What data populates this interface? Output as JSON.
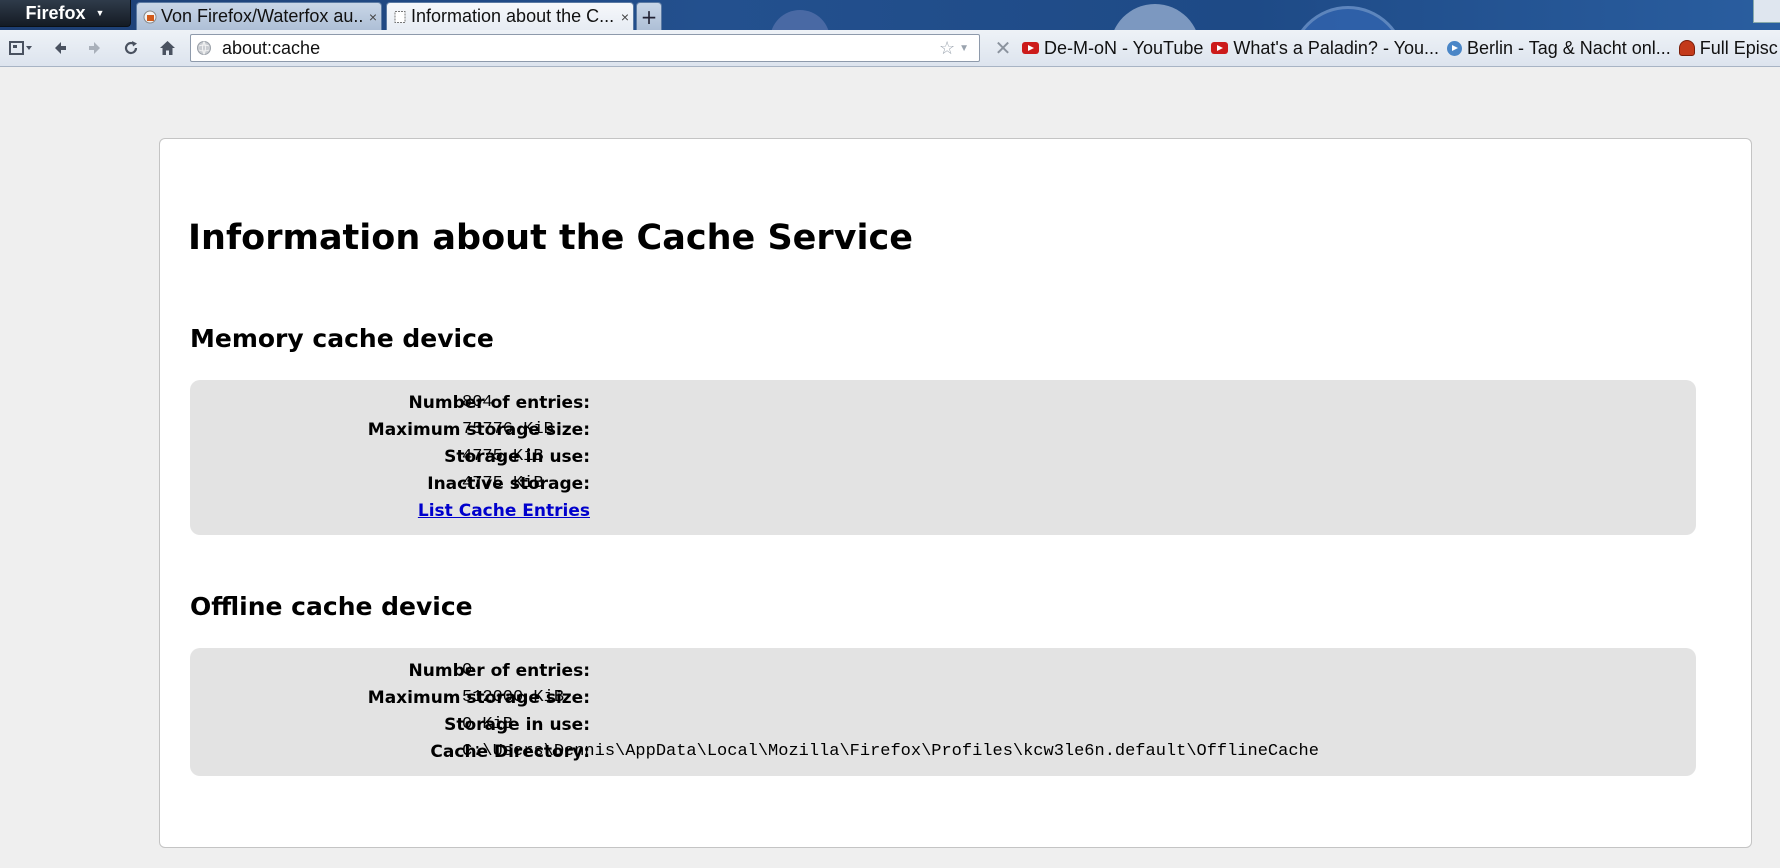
{
  "browser": {
    "menu_label": "Firefox",
    "tabs": [
      {
        "title": "Von Firefox/Waterfox au...",
        "close": "×",
        "active": false
      },
      {
        "title": "Information about the C...",
        "close": "×",
        "active": true
      }
    ],
    "new_tab": "+",
    "url": "about:cache",
    "bookmarks": [
      {
        "label": "De-M-oN - YouTube",
        "icon": "youtube-icon"
      },
      {
        "label": "What's a Paladin? - You...",
        "icon": "youtube-icon"
      },
      {
        "label": "Berlin - Tag & Nacht onl...",
        "icon": "play-circle-icon"
      },
      {
        "label": "Full Episc",
        "icon": "character-icon"
      }
    ]
  },
  "page": {
    "title": "Information about the Cache Service",
    "memory": {
      "heading": "Memory cache device",
      "rows": [
        {
          "label": "Number of entries:",
          "value": "804"
        },
        {
          "label": "Maximum storage size:",
          "value": "75776 KiB"
        },
        {
          "label": "Storage in use:",
          "value": "4775 KiB"
        },
        {
          "label": "Inactive storage:",
          "value": "4775 KiB"
        }
      ],
      "link": "List Cache Entries"
    },
    "offline": {
      "heading": "Offline cache device",
      "rows": [
        {
          "label": "Number of entries:",
          "value": "0"
        },
        {
          "label": "Maximum storage size:",
          "value": "512000 KiB"
        },
        {
          "label": "Storage in use:",
          "value": "0 KiB"
        },
        {
          "label": "Cache Directory:",
          "value": "C:\\Users\\Dennis\\AppData\\Local\\Mozilla\\Firefox\\Profiles\\kcw3le6n.default\\OfflineCache"
        }
      ]
    }
  },
  "colors": {
    "link": "#0000cc",
    "panel_bg": "#e3e3e3",
    "page_bg": "#efefef"
  }
}
